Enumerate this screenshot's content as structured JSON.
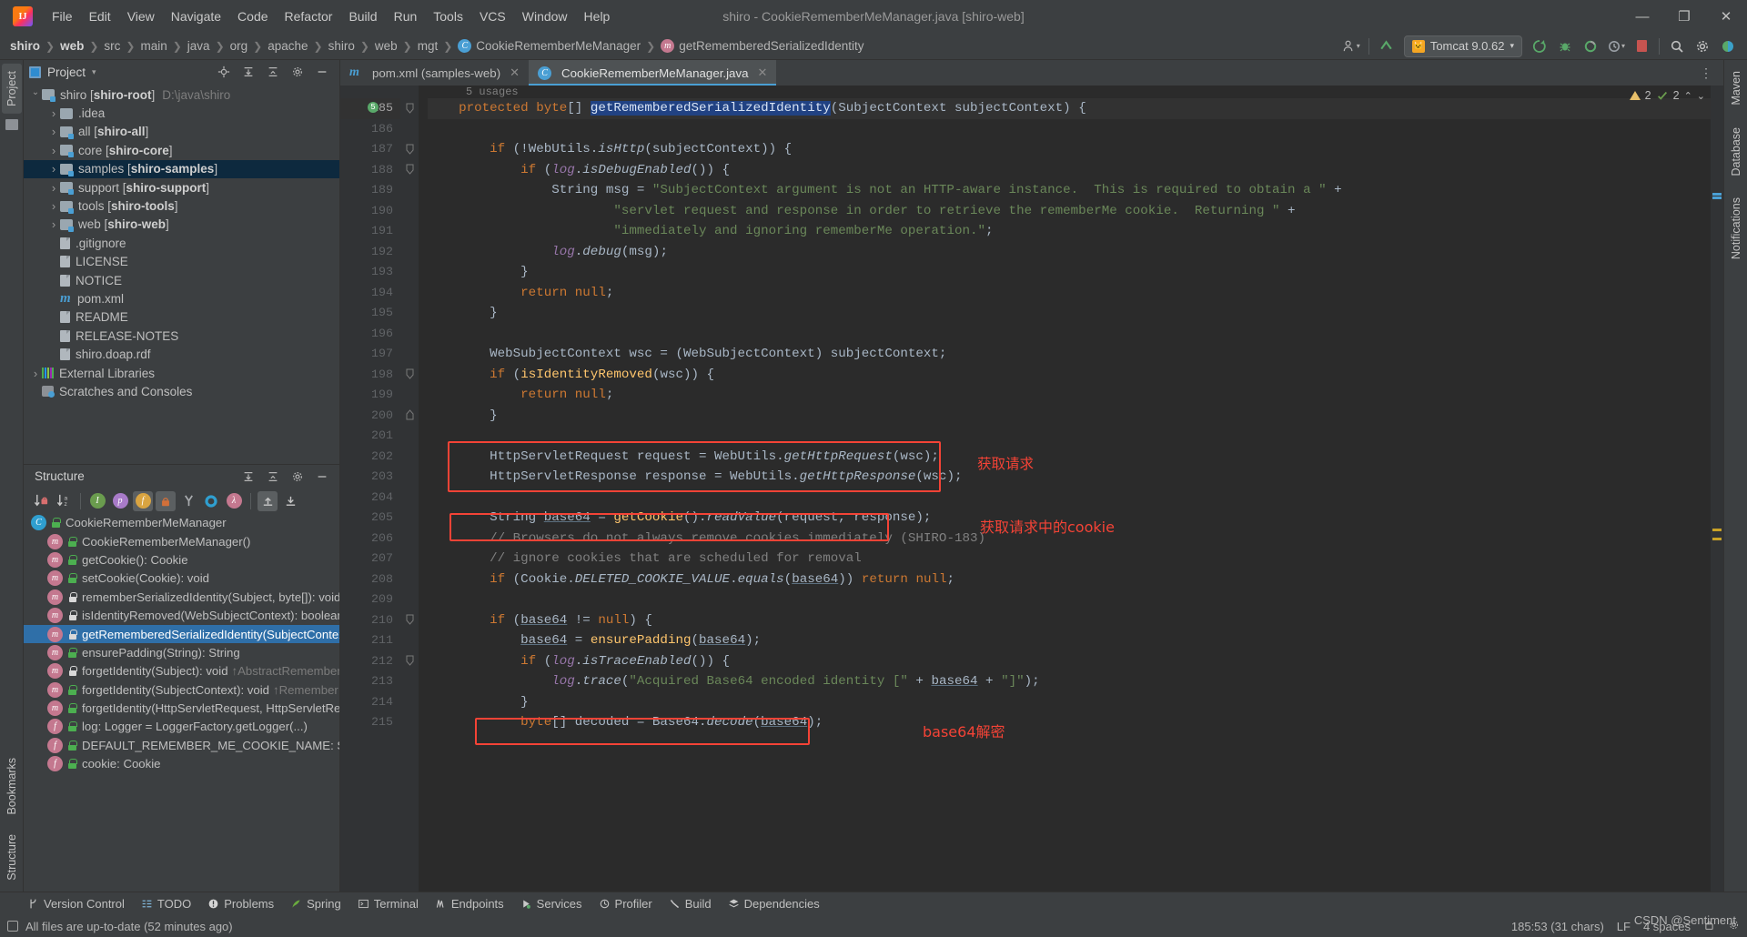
{
  "window": {
    "title": "shiro - CookieRememberMeManager.java [shiro-web]",
    "minimize": "—",
    "maximize": "❐",
    "close": "✕"
  },
  "menu": [
    "File",
    "Edit",
    "View",
    "Navigate",
    "Code",
    "Refactor",
    "Build",
    "Run",
    "Tools",
    "VCS",
    "Window",
    "Help"
  ],
  "breadcrumb": [
    {
      "label": "shiro",
      "bold": true,
      "icon": ""
    },
    {
      "label": "web",
      "bold": true,
      "icon": ""
    },
    {
      "label": "src",
      "bold": false,
      "icon": ""
    },
    {
      "label": "main",
      "bold": false,
      "icon": ""
    },
    {
      "label": "java",
      "bold": false,
      "icon": ""
    },
    {
      "label": "org",
      "bold": false,
      "icon": ""
    },
    {
      "label": "apache",
      "bold": false,
      "icon": ""
    },
    {
      "label": "shiro",
      "bold": false,
      "icon": ""
    },
    {
      "label": "web",
      "bold": false,
      "icon": ""
    },
    {
      "label": "mgt",
      "bold": false,
      "icon": ""
    },
    {
      "label": "CookieRememberMeManager",
      "bold": false,
      "icon": "class-icon"
    },
    {
      "label": "getRememberedSerializedIdentity",
      "bold": false,
      "icon": "method-icon"
    }
  ],
  "toolbar": {
    "run_config": "Tomcat 9.0.62",
    "run_config_caret": "▾",
    "profile_icon": "user-profile-icon",
    "updates_icon": "update-arrow-icon",
    "run_icon": "run-icon",
    "debug_icon": "debug-icon",
    "coverage_icon": "coverage-icon",
    "profiler_icon": "profiler-icon",
    "stop_icon": "stop-icon",
    "search_icon": "search-icon",
    "settings_icon": "gear-icon",
    "ide_icon": "ide-icon"
  },
  "project_panel": {
    "title": "Project",
    "dropdown": "▾",
    "actions": [
      "locate-icon",
      "expand-all-icon",
      "collapse-all-icon",
      "settings-icon",
      "hide-icon"
    ],
    "tree": [
      {
        "label": "shiro",
        "module": "[shiro-root]",
        "path": "D:\\java\\shiro",
        "indent": 0,
        "chev": "open",
        "icon": "module-folder-icon",
        "selected": false
      },
      {
        "label": ".idea",
        "module": "",
        "path": "",
        "indent": 1,
        "chev": "closed",
        "icon": "folder-icon",
        "selected": false
      },
      {
        "label": "all",
        "module": "[shiro-all]",
        "path": "",
        "indent": 1,
        "chev": "closed",
        "icon": "module-folder-icon",
        "selected": false
      },
      {
        "label": "core",
        "module": "[shiro-core]",
        "path": "",
        "indent": 1,
        "chev": "closed",
        "icon": "module-folder-icon",
        "selected": false
      },
      {
        "label": "samples",
        "module": "[shiro-samples]",
        "path": "",
        "indent": 1,
        "chev": "closed",
        "icon": "module-folder-icon",
        "selected": true
      },
      {
        "label": "support",
        "module": "[shiro-support]",
        "path": "",
        "indent": 1,
        "chev": "closed",
        "icon": "module-folder-icon",
        "selected": false
      },
      {
        "label": "tools",
        "module": "[shiro-tools]",
        "path": "",
        "indent": 1,
        "chev": "closed",
        "icon": "module-folder-icon",
        "selected": false
      },
      {
        "label": "web",
        "module": "[shiro-web]",
        "path": "",
        "indent": 1,
        "chev": "closed",
        "icon": "module-folder-icon",
        "selected": false
      },
      {
        "label": ".gitignore",
        "module": "",
        "path": "",
        "indent": 1,
        "chev": "none",
        "icon": "gitignore-file-icon",
        "selected": false
      },
      {
        "label": "LICENSE",
        "module": "",
        "path": "",
        "indent": 1,
        "chev": "none",
        "icon": "file-icon",
        "selected": false
      },
      {
        "label": "NOTICE",
        "module": "",
        "path": "",
        "indent": 1,
        "chev": "none",
        "icon": "file-icon",
        "selected": false
      },
      {
        "label": "pom.xml",
        "module": "",
        "path": "",
        "indent": 1,
        "chev": "none",
        "icon": "maven-file-icon",
        "selected": false
      },
      {
        "label": "README",
        "module": "",
        "path": "",
        "indent": 1,
        "chev": "none",
        "icon": "file-icon",
        "selected": false
      },
      {
        "label": "RELEASE-NOTES",
        "module": "",
        "path": "",
        "indent": 1,
        "chev": "none",
        "icon": "file-icon",
        "selected": false
      },
      {
        "label": "shiro.doap.rdf",
        "module": "",
        "path": "",
        "indent": 1,
        "chev": "none",
        "icon": "file-icon",
        "selected": false
      },
      {
        "label": "External Libraries",
        "module": "",
        "path": "",
        "indent": 0,
        "chev": "closed",
        "icon": "library-icon",
        "selected": false
      },
      {
        "label": "Scratches and Consoles",
        "module": "",
        "path": "",
        "indent": 0,
        "chev": "none",
        "icon": "scratches-icon",
        "selected": false
      }
    ]
  },
  "structure_panel": {
    "title": "Structure",
    "toolbar_icons": [
      "sort-by-visibility-icon",
      "sort-alphabetically-icon",
      "show-inherited-icon",
      "show-properties-icon",
      "show-fields-icon",
      "show-non-public-icon",
      "show-anonymous-icon",
      "show-interfaces-icon",
      "show-lambdas-icon",
      "expand-all-icon",
      "collapse-all-icon"
    ],
    "items": [
      {
        "label": "CookieRememberMeManager",
        "kind": "class",
        "vis": "pub",
        "indent": 0,
        "selected": false,
        "override": ""
      },
      {
        "label": "CookieRememberMeManager()",
        "kind": "method",
        "vis": "pub",
        "indent": 1,
        "selected": false,
        "override": ""
      },
      {
        "label": "getCookie(): Cookie",
        "kind": "method",
        "vis": "pub",
        "indent": 1,
        "selected": false,
        "override": ""
      },
      {
        "label": "setCookie(Cookie): void",
        "kind": "method",
        "vis": "pub",
        "indent": 1,
        "selected": false,
        "override": ""
      },
      {
        "label": "rememberSerializedIdentity(Subject, byte[]): void",
        "kind": "method",
        "vis": "prot",
        "indent": 1,
        "selected": false,
        "override": ""
      },
      {
        "label": "isIdentityRemoved(WebSubjectContext): boolean",
        "kind": "method",
        "vis": "prot",
        "indent": 1,
        "selected": false,
        "override": ""
      },
      {
        "label": "getRememberedSerializedIdentity(SubjectContext",
        "kind": "method",
        "vis": "prot",
        "indent": 1,
        "selected": true,
        "override": ""
      },
      {
        "label": "ensurePadding(String): String",
        "kind": "method",
        "vis": "pub",
        "indent": 1,
        "selected": false,
        "override": ""
      },
      {
        "label": "forgetIdentity(Subject): void",
        "kind": "method",
        "vis": "prot",
        "indent": 1,
        "selected": false,
        "override": "↑AbstractRemember"
      },
      {
        "label": "forgetIdentity(SubjectContext): void",
        "kind": "method",
        "vis": "pub",
        "indent": 1,
        "selected": false,
        "override": "↑Remember"
      },
      {
        "label": "forgetIdentity(HttpServletRequest, HttpServletRe",
        "kind": "method",
        "vis": "pub",
        "indent": 1,
        "selected": false,
        "override": ""
      },
      {
        "label": "log: Logger = LoggerFactory.getLogger(...)",
        "kind": "field",
        "vis": "pub",
        "indent": 1,
        "selected": false,
        "override": ""
      },
      {
        "label": "DEFAULT_REMEMBER_ME_COOKIE_NAME: String =",
        "kind": "field",
        "vis": "pub",
        "indent": 1,
        "selected": false,
        "override": ""
      },
      {
        "label": "cookie: Cookie",
        "kind": "field",
        "vis": "pub",
        "indent": 1,
        "selected": false,
        "override": ""
      }
    ]
  },
  "left_stripe": {
    "top": [
      "Project"
    ],
    "bottom": [
      "Bookmarks",
      "Structure"
    ]
  },
  "right_stripe": [
    "Maven",
    "Database",
    "Notifications"
  ],
  "editor": {
    "tabs": [
      {
        "label": "pom.xml (samples-web)",
        "icon": "maven-file-icon",
        "active": false,
        "close": "✕"
      },
      {
        "label": "CookieRememberMeManager.java",
        "icon": "class-icon",
        "active": true,
        "close": "✕"
      }
    ],
    "usage_hint": "5 usages",
    "inspections": {
      "warnings": "2",
      "weak_warnings": "2",
      "up": "⌃",
      "down": "⌄"
    },
    "first_line_number": 185,
    "current_line": 185,
    "lines": [
      {
        "n": 185,
        "fold": "collapse",
        "marker": "usage-gutter-icon"
      },
      {
        "n": 186,
        "fold": "",
        "marker": ""
      },
      {
        "n": 187,
        "fold": "collapse",
        "marker": ""
      },
      {
        "n": 188,
        "fold": "collapse",
        "marker": ""
      },
      {
        "n": 189,
        "fold": "",
        "marker": ""
      },
      {
        "n": 190,
        "fold": "",
        "marker": ""
      },
      {
        "n": 191,
        "fold": "",
        "marker": ""
      },
      {
        "n": 192,
        "fold": "",
        "marker": ""
      },
      {
        "n": 193,
        "fold": "",
        "marker": ""
      },
      {
        "n": 194,
        "fold": "",
        "marker": ""
      },
      {
        "n": 195,
        "fold": "",
        "marker": ""
      },
      {
        "n": 196,
        "fold": "",
        "marker": ""
      },
      {
        "n": 197,
        "fold": "",
        "marker": ""
      },
      {
        "n": 198,
        "fold": "collapse",
        "marker": ""
      },
      {
        "n": 199,
        "fold": "",
        "marker": ""
      },
      {
        "n": 200,
        "fold": "end",
        "marker": ""
      },
      {
        "n": 201,
        "fold": "",
        "marker": ""
      },
      {
        "n": 202,
        "fold": "",
        "marker": ""
      },
      {
        "n": 203,
        "fold": "",
        "marker": ""
      },
      {
        "n": 204,
        "fold": "",
        "marker": ""
      },
      {
        "n": 205,
        "fold": "",
        "marker": ""
      },
      {
        "n": 206,
        "fold": "",
        "marker": ""
      },
      {
        "n": 207,
        "fold": "",
        "marker": ""
      },
      {
        "n": 208,
        "fold": "",
        "marker": ""
      },
      {
        "n": 209,
        "fold": "",
        "marker": ""
      },
      {
        "n": 210,
        "fold": "collapse",
        "marker": ""
      },
      {
        "n": 211,
        "fold": "",
        "marker": ""
      },
      {
        "n": 212,
        "fold": "collapse",
        "marker": ""
      },
      {
        "n": 213,
        "fold": "",
        "marker": ""
      },
      {
        "n": 214,
        "fold": "",
        "marker": ""
      },
      {
        "n": 215,
        "fold": "",
        "marker": ""
      }
    ],
    "code_text": [
      "    protected byte[] getRememberedSerializedIdentity(SubjectContext subjectContext) {",
      "",
      "        if (!WebUtils.isHttp(subjectContext)) {",
      "            if (log.isDebugEnabled()) {",
      "                String msg = \"SubjectContext argument is not an HTTP-aware instance.  This is required to obtain a \" +",
      "                        \"servlet request and response in order to retrieve the rememberMe cookie.  Returning \" +",
      "                        \"immediately and ignoring rememberMe operation.\";",
      "                log.debug(msg);",
      "            }",
      "            return null;",
      "        }",
      "",
      "        WebSubjectContext wsc = (WebSubjectContext) subjectContext;",
      "        if (isIdentityRemoved(wsc)) {",
      "            return null;",
      "        }",
      "",
      "        HttpServletRequest request = WebUtils.getHttpRequest(wsc);",
      "        HttpServletResponse response = WebUtils.getHttpResponse(wsc);",
      "",
      "        String base64 = getCookie().readValue(request, response);",
      "        // Browsers do not always remove cookies immediately (SHIRO-183)",
      "        // ignore cookies that are scheduled for removal",
      "        if (Cookie.DELETED_COOKIE_VALUE.equals(base64)) return null;",
      "",
      "        if (base64 != null) {",
      "            base64 = ensurePadding(base64);",
      "            if (log.isTraceEnabled()) {",
      "                log.trace(\"Acquired Base64 encoded identity [\" + base64 + \"]\");",
      "            }",
      "            byte[] decoded = Base64.decode(base64);"
    ],
    "selected_token": "getRememberedSerializedIdentity",
    "annotations": [
      {
        "text": "获取请求",
        "for_lines": "202-203"
      },
      {
        "text": "获取请求中的cookie",
        "for_lines": "205"
      },
      {
        "text": "base64解密",
        "for_lines": "215"
      }
    ]
  },
  "bottom_bar": [
    {
      "label": "Version Control",
      "icon": "branch-icon"
    },
    {
      "label": "TODO",
      "icon": "todo-icon"
    },
    {
      "label": "Problems",
      "icon": "problems-icon"
    },
    {
      "label": "Spring",
      "icon": "spring-leaf-icon"
    },
    {
      "label": "Terminal",
      "icon": "terminal-icon"
    },
    {
      "label": "Endpoints",
      "icon": "endpoints-icon"
    },
    {
      "label": "Services",
      "icon": "services-icon"
    },
    {
      "label": "Profiler",
      "icon": "profiler-icon"
    },
    {
      "label": "Build",
      "icon": "build-hammer-icon"
    },
    {
      "label": "Dependencies",
      "icon": "dependencies-icon"
    }
  ],
  "status_bar": {
    "message": "All files are up-to-date (52 minutes ago)",
    "message_icon": "save-icon",
    "caret": "185:53 (31 chars)",
    "line_separator": "LF",
    "indent": "4 spaces",
    "lock_icon": "lock-icon",
    "settings_icon": "gear-icon",
    "watermark": "CSDN @Sentiment"
  },
  "colors": {
    "accent": "#4a9fd4",
    "annotation_red": "#f44336",
    "selection_blue": "#214283",
    "editor_bg": "#2b2b2b",
    "panel_bg": "#3c3f41"
  }
}
